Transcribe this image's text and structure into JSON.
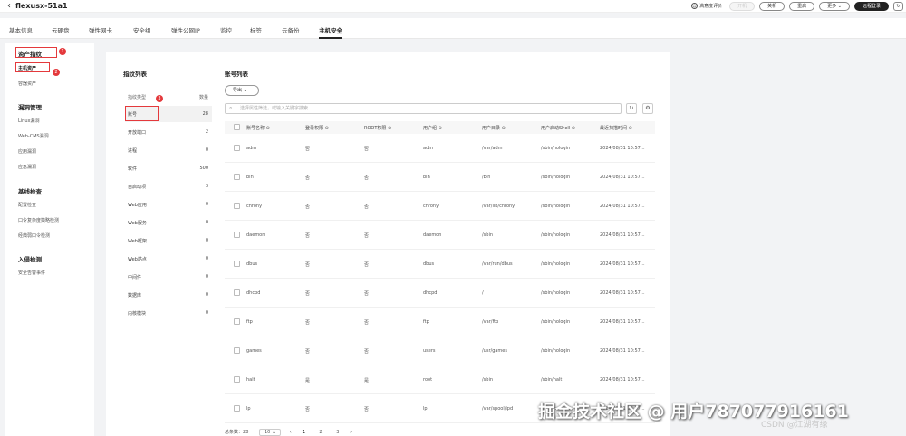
{
  "header": {
    "back_icon": "chevron-left-icon",
    "title": "flexusx-51a1",
    "feedback": "满意度评价",
    "buttons": [
      "开机",
      "关机",
      "重启",
      "更多",
      "远程登录"
    ],
    "refresh_icon": "refresh-icon"
  },
  "tabs": [
    "基本信息",
    "云硬盘",
    "弹性网卡",
    "安全组",
    "弹性公网IP",
    "监控",
    "标签",
    "云备份",
    "主机安全"
  ],
  "sidebar": {
    "groups": [
      {
        "title": "资产指纹",
        "items": [
          "主机资产",
          "容器资产"
        ]
      },
      {
        "title": "漏洞管理",
        "items": [
          "Linux漏洞",
          "Web-CMS漏洞",
          "应用漏洞",
          "应急漏洞"
        ]
      },
      {
        "title": "基线检查",
        "items": [
          "配置检查",
          "口令复杂度策略检测",
          "经典弱口令检测"
        ]
      },
      {
        "title": "入侵检测",
        "items": [
          "安全告警事件"
        ]
      }
    ],
    "badges": [
      "1",
      "2"
    ]
  },
  "fingerprint": {
    "title": "指纹列表",
    "head_type": "指纹类型",
    "head_count": "数量",
    "badge": "3",
    "rows": [
      {
        "name": "账号",
        "count": "28"
      },
      {
        "name": "开放端口",
        "count": "2"
      },
      {
        "name": "进程",
        "count": "0"
      },
      {
        "name": "软件",
        "count": "500"
      },
      {
        "name": "自启动项",
        "count": "3"
      },
      {
        "name": "Web应用",
        "count": "0"
      },
      {
        "name": "Web服务",
        "count": "0"
      },
      {
        "name": "Web框架",
        "count": "0"
      },
      {
        "name": "Web站点",
        "count": "0"
      },
      {
        "name": "中间件",
        "count": "0"
      },
      {
        "name": "数据库",
        "count": "0"
      },
      {
        "name": "内核模块",
        "count": "0"
      }
    ]
  },
  "accounts": {
    "title": "账号列表",
    "export_label": "导出",
    "search_placeholder": "选择属性筛选，或输入关键字搜索",
    "columns": [
      "账号名称",
      "登录权限",
      "ROOT权限",
      "用户组",
      "用户目录",
      "用户启动Shell",
      "最近扫描时间"
    ],
    "rows": [
      [
        "adm",
        "否",
        "否",
        "adm",
        "/var/adm",
        "/sbin/nologin",
        "2024/08/31 10:57..."
      ],
      [
        "bin",
        "否",
        "否",
        "bin",
        "/bin",
        "/sbin/nologin",
        "2024/08/31 10:57..."
      ],
      [
        "chrony",
        "否",
        "否",
        "chrony",
        "/var/lib/chrony",
        "/sbin/nologin",
        "2024/08/31 10:57..."
      ],
      [
        "daemon",
        "否",
        "否",
        "daemon",
        "/sbin",
        "/sbin/nologin",
        "2024/08/31 10:57..."
      ],
      [
        "dbus",
        "否",
        "否",
        "dbus",
        "/var/run/dbus",
        "/sbin/nologin",
        "2024/08/31 10:57..."
      ],
      [
        "dhcpd",
        "否",
        "否",
        "dhcpd",
        "/",
        "/sbin/nologin",
        "2024/08/31 10:57..."
      ],
      [
        "ftp",
        "否",
        "否",
        "ftp",
        "/var/ftp",
        "/sbin/nologin",
        "2024/08/31 10:57..."
      ],
      [
        "games",
        "否",
        "否",
        "users",
        "/usr/games",
        "/sbin/nologin",
        "2024/08/31 10:57..."
      ],
      [
        "halt",
        "是",
        "是",
        "root",
        "/sbin",
        "/sbin/halt",
        "2024/08/31 10:57..."
      ],
      [
        "lp",
        "否",
        "否",
        "lp",
        "/var/spool/lpd",
        "/sbin/nologin",
        "2024/08/31 10:57..."
      ]
    ],
    "pager": {
      "total_label": "总条数：",
      "total": "28",
      "page_size": "10",
      "pages": [
        "1",
        "2",
        "3"
      ]
    }
  },
  "watermark": "掘金技术社区 @ 用户787077916161",
  "csdn_mark": "CSDN @江湖有缘"
}
